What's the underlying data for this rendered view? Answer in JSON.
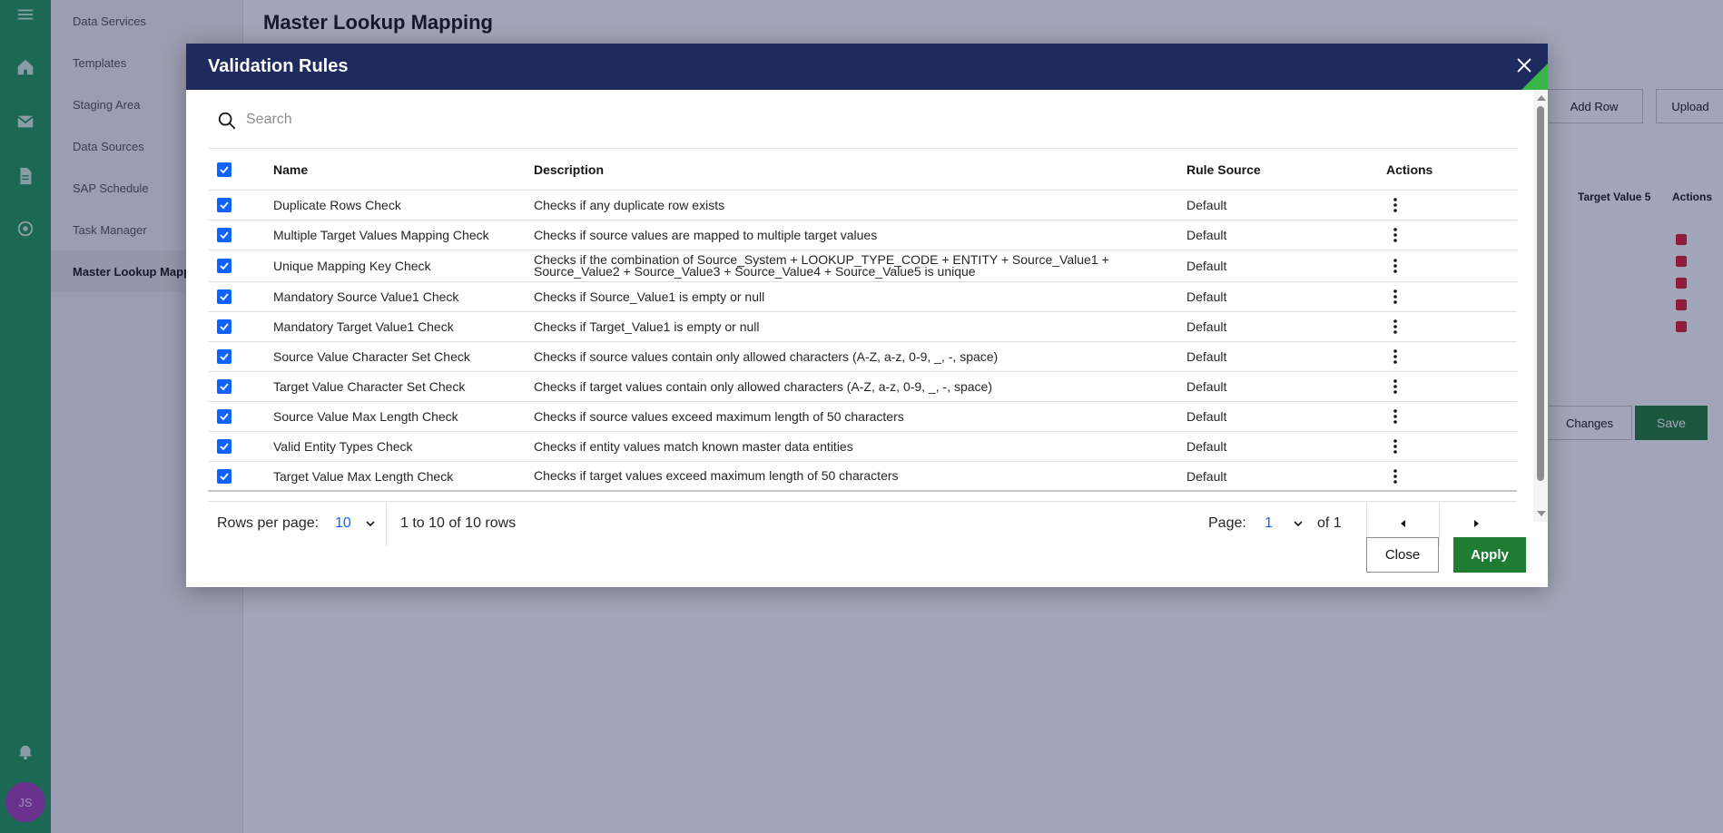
{
  "background": {
    "nav_items": [
      "Data Services",
      "Templates",
      "Staging Area",
      "Data Sources",
      "SAP Schedule",
      "Task Manager",
      "Master Lookup Mapping"
    ],
    "page_title": "Master Lookup Mapping",
    "add_row_label": "Add Row",
    "upload_label": "Upload",
    "col_heads": [
      "Target Value 5",
      "Actions"
    ],
    "discard_label": "Changes",
    "save_label": "Save",
    "avatar_initials": "JS"
  },
  "modal": {
    "title": "Validation Rules",
    "search_placeholder": "Search",
    "columns": {
      "name": "Name",
      "description": "Description",
      "rule_source": "Rule Source",
      "actions": "Actions"
    },
    "rows": [
      {
        "checked": true,
        "name": "Duplicate Rows Check",
        "description": "Checks if any duplicate row exists",
        "source": "Default"
      },
      {
        "checked": true,
        "name": "Multiple Target Values Mapping Check",
        "description": "Checks if source values are mapped to multiple target values",
        "source": "Default"
      },
      {
        "checked": true,
        "name": "Unique Mapping Key Check",
        "description": "Checks if the combination of Source_System + LOOKUP_TYPE_CODE + ENTITY + Source_Value1 + Source_Value2 + Source_Value3 + Source_Value4 + Source_Value5 is unique",
        "source": "Default"
      },
      {
        "checked": true,
        "name": "Mandatory Source Value1 Check",
        "description": "Checks if Source_Value1 is empty or null",
        "source": "Default"
      },
      {
        "checked": true,
        "name": "Mandatory Target Value1 Check",
        "description": "Checks if Target_Value1 is empty or null",
        "source": "Default"
      },
      {
        "checked": true,
        "name": "Source Value Character Set Check",
        "description": "Checks if source values contain only allowed characters (A-Z, a-z, 0-9, _, -, space)",
        "source": "Default"
      },
      {
        "checked": true,
        "name": "Target Value Character Set Check",
        "description": "Checks if target values contain only allowed characters (A-Z, a-z, 0-9, _, -, space)",
        "source": "Default"
      },
      {
        "checked": true,
        "name": "Source Value Max Length Check",
        "description": "Checks if source values exceed maximum length of 50 characters",
        "source": "Default"
      },
      {
        "checked": true,
        "name": "Valid Entity Types Check",
        "description": "Checks if entity values match known master data entities",
        "source": "Default"
      },
      {
        "checked": true,
        "name": "Target Value Max Length Check",
        "description": "Checks if target values exceed maximum length of 50 characters",
        "source": "Default"
      }
    ],
    "pagination": {
      "rows_per_page_label": "Rows per page:",
      "rows_per_page_value": "10",
      "range_text": "1 to 10 of 10 rows",
      "page_label": "Page:",
      "page_value": "1",
      "of_text": "of 1"
    },
    "close_label": "Close",
    "apply_label": "Apply"
  },
  "colors": {
    "rail": "#1e9a57",
    "modal_header": "#1f2a5f",
    "accent_green": "#3ab549",
    "checkbox": "#0f62fe",
    "apply_button": "#1e7d32"
  },
  "icons": [
    "home-icon",
    "mail-icon",
    "document-icon",
    "settings-icon",
    "bell-icon",
    "search-icon",
    "close-icon",
    "kebab-icon",
    "chevron-down-icon",
    "caret-left-icon",
    "caret-right-icon"
  ]
}
